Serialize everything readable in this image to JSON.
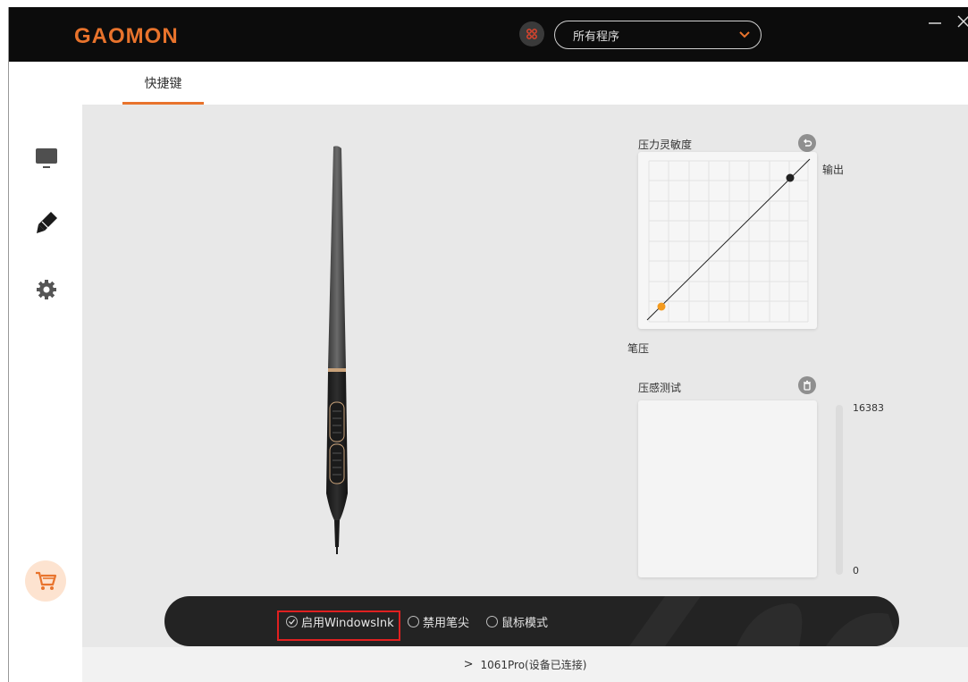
{
  "app": {
    "logo_text": "GAOMON",
    "program_select": {
      "value": "所有程序"
    },
    "accent_color": "#e8732c"
  },
  "tabs": [
    {
      "label": "快捷键",
      "active": true
    }
  ],
  "sidebar": {
    "items": [
      {
        "icon": "monitor-icon"
      },
      {
        "icon": "pen-icon",
        "active": true
      },
      {
        "icon": "gear-icon"
      },
      {
        "icon": "cart-icon"
      }
    ]
  },
  "pressure": {
    "sensitivity_label": "压力灵敏度",
    "output_label": "输出",
    "pen_pressure_label": "笔压",
    "test_label": "压感测试",
    "max_value": "16383",
    "min_value": "0"
  },
  "modes": {
    "options": [
      {
        "label": "启用WindowsInk",
        "checked": true
      },
      {
        "label": "禁用笔尖",
        "checked": false
      },
      {
        "label": "鼠标模式",
        "checked": false
      }
    ]
  },
  "footer": {
    "device_status": "1061Pro(设备已连接)"
  }
}
